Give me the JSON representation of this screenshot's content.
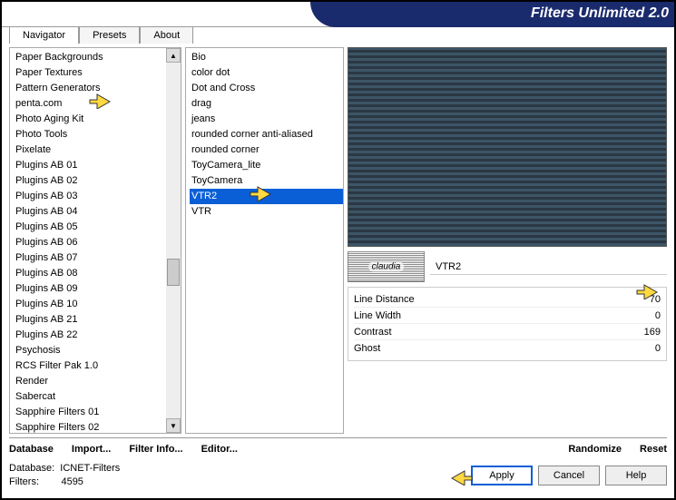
{
  "title": "Filters Unlimited 2.0",
  "tabs": {
    "navigator": "Navigator",
    "presets": "Presets",
    "about": "About"
  },
  "categories": [
    "Paper Backgrounds",
    "Paper Textures",
    "Pattern Generators",
    "penta.com",
    "Photo Aging Kit",
    "Photo Tools",
    "Pixelate",
    "Plugins AB 01",
    "Plugins AB 02",
    "Plugins AB 03",
    "Plugins AB 04",
    "Plugins AB 05",
    "Plugins AB 06",
    "Plugins AB 07",
    "Plugins AB 08",
    "Plugins AB 09",
    "Plugins AB 10",
    "Plugins AB 21",
    "Plugins AB 22",
    "Psychosis",
    "RCS Filter Pak 1.0",
    "Render",
    "Sabercat",
    "Sapphire Filters 01",
    "Sapphire Filters 02"
  ],
  "filters": [
    "Bio",
    "color dot",
    "Dot and Cross",
    "drag",
    "jeans",
    "rounded corner anti-aliased",
    "rounded corner",
    "ToyCamera_lite",
    "ToyCamera",
    "VTR2",
    "VTR"
  ],
  "selected_filter_index": 9,
  "logo_text": "claudia",
  "filter_title": "VTR2",
  "params": [
    {
      "label": "Line Distance",
      "value": "70"
    },
    {
      "label": "Line Width",
      "value": "0"
    },
    {
      "label": "Contrast",
      "value": "169"
    },
    {
      "label": "Ghost",
      "value": "0"
    }
  ],
  "bottom": {
    "database": "Database",
    "import": "Import...",
    "filter_info": "Filter Info...",
    "editor": "Editor...",
    "randomize": "Randomize",
    "reset": "Reset"
  },
  "status": {
    "database_label": "Database:",
    "database_value": "ICNET-Filters",
    "filters_label": "Filters:",
    "filters_value": "4595"
  },
  "buttons": {
    "apply": "Apply",
    "cancel": "Cancel",
    "help": "Help"
  }
}
